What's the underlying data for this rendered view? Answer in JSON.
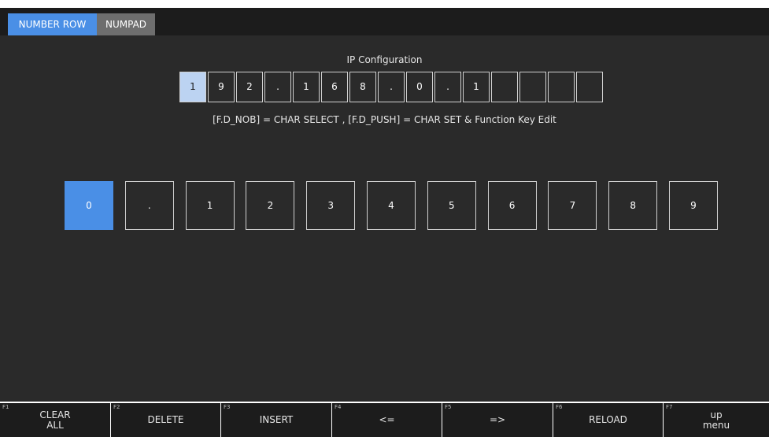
{
  "tabs": [
    {
      "label": "NUMBER ROW",
      "active": true
    },
    {
      "label": "NUMPAD",
      "active": false
    }
  ],
  "ip_config": {
    "title": "IP Configuration",
    "chars": [
      "1",
      "9",
      "2",
      ".",
      "1",
      "6",
      "8",
      ".",
      "0",
      ".",
      "1",
      "",
      "",
      "",
      ""
    ],
    "cursor_index": 0
  },
  "hint": "[F.D_NOB] = CHAR SELECT , [F.D_PUSH] = CHAR SET & Function Key Edit",
  "char_keys": {
    "items": [
      "0",
      ".",
      "1",
      "2",
      "3",
      "4",
      "5",
      "6",
      "7",
      "8",
      "9"
    ],
    "selected_index": 0
  },
  "function_keys": [
    {
      "num": "F1",
      "label": "CLEAR\nALL"
    },
    {
      "num": "F2",
      "label": "DELETE"
    },
    {
      "num": "F3",
      "label": "INSERT"
    },
    {
      "num": "F4",
      "label": "<="
    },
    {
      "num": "F5",
      "label": "=>"
    },
    {
      "num": "F6",
      "label": "RELOAD"
    },
    {
      "num": "F7",
      "label": "up\nmenu"
    }
  ],
  "colors": {
    "accent": "#4a8fe6",
    "active_cell": "#bcd3f2",
    "background": "#2a2a2a",
    "bar": "#1c1c1c"
  }
}
